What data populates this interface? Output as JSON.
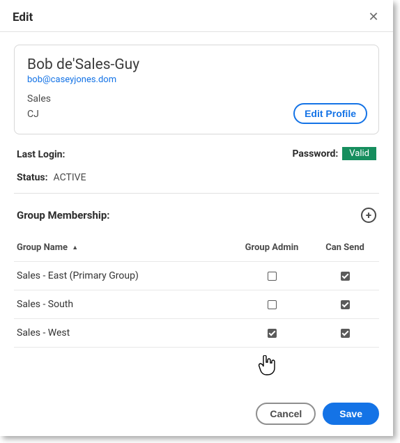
{
  "modal": {
    "title": "Edit",
    "close": "✕"
  },
  "profile": {
    "name": "Bob de'Sales-Guy",
    "email": "bob@caseyjones.dom",
    "department": "Sales",
    "initials": "CJ",
    "edit_button": "Edit Profile"
  },
  "info": {
    "last_login_label": "Last Login:",
    "last_login_value": "",
    "password_label": "Password:",
    "password_badge": "Valid",
    "status_label": "Status:",
    "status_value": "ACTIVE"
  },
  "membership": {
    "title": "Group Membership:",
    "add_icon": "+",
    "columns": {
      "name": "Group Name",
      "admin": "Group Admin",
      "send": "Can Send"
    },
    "rows": [
      {
        "name": "Sales - East (Primary Group)",
        "admin": false,
        "send": true
      },
      {
        "name": "Sales - South",
        "admin": false,
        "send": true
      },
      {
        "name": "Sales - West",
        "admin": true,
        "send": true
      }
    ]
  },
  "footer": {
    "cancel": "Cancel",
    "save": "Save"
  }
}
